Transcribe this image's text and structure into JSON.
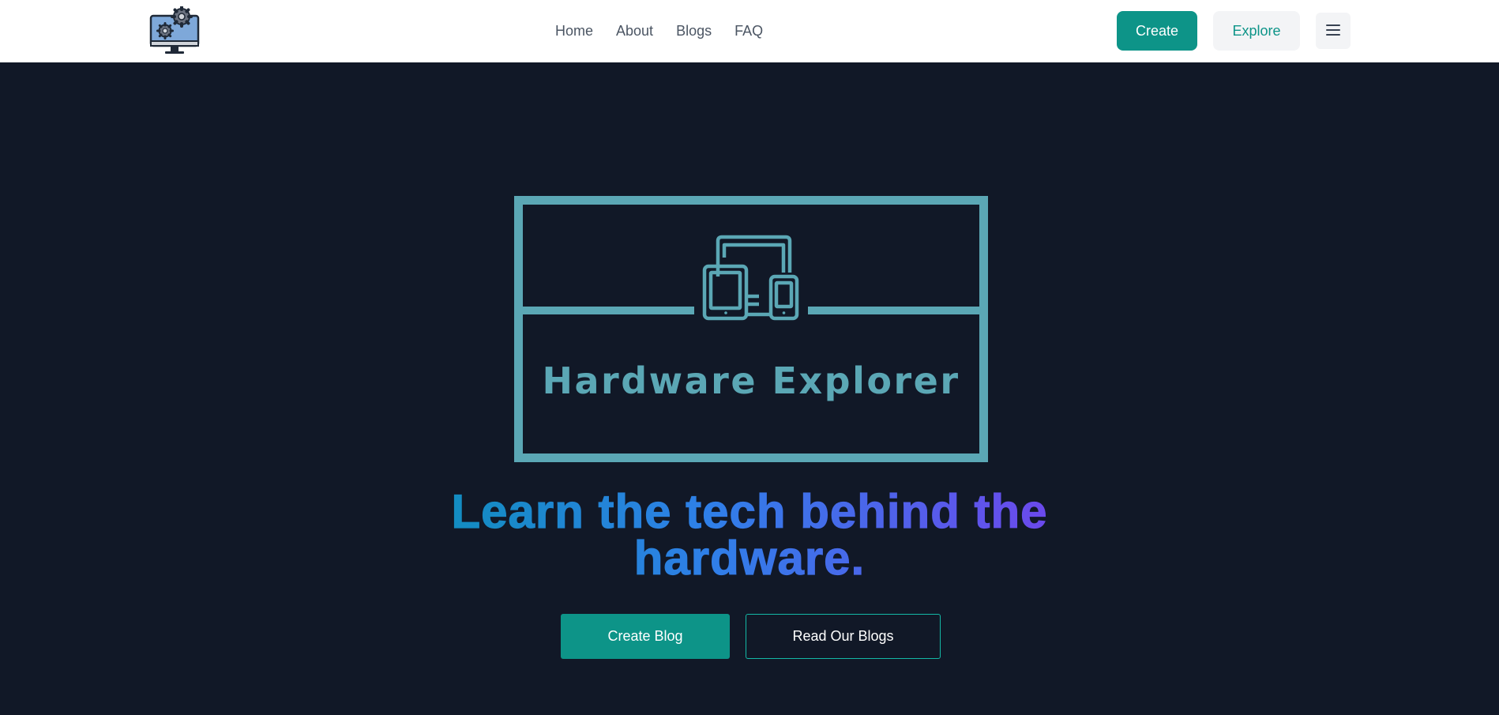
{
  "nav": {
    "links": [
      "Home",
      "About",
      "Blogs",
      "FAQ"
    ],
    "create_label": "Create",
    "explore_label": "Explore",
    "menu_icon": "hamburger-menu-icon",
    "logo_icon": "monitor-gears-icon"
  },
  "hero": {
    "brand_title": "Hardware Explorer",
    "brand_icon": "devices-icon",
    "headline": "Learn the tech behind the hardware.",
    "create_blog_label": "Create Blog",
    "read_blogs_label": "Read Our Blogs"
  },
  "colors": {
    "background": "#111827",
    "accent": "#0d9488",
    "brand_teal": "#5ba7b5",
    "gradient": [
      "#0891b2",
      "#2f7fe8",
      "#7c3aed"
    ]
  }
}
